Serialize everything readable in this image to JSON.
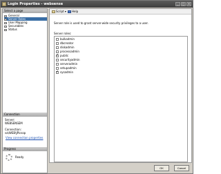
{
  "window": {
    "title": "Login Properties - websense",
    "controls": [
      "_",
      "□",
      "✕"
    ]
  },
  "left": {
    "select_page_header": "Select a page",
    "pages": [
      {
        "label": "General",
        "selected": false
      },
      {
        "label": "Server Roles",
        "selected": true
      },
      {
        "label": "User Mapping",
        "selected": false
      },
      {
        "label": "Securables",
        "selected": false
      },
      {
        "label": "Status",
        "selected": false
      }
    ],
    "connection_header": "Connection",
    "server_label": "Server:",
    "server_value": "WEBSENSEM",
    "connection_label": "Connection:",
    "connection_value": "sa\\WEB\\JPicsop",
    "view_link": "View connection properties",
    "progress_header": "Progress",
    "progress_status": "Ready"
  },
  "toolbar": {
    "script_label": "Script",
    "help_label": "Help"
  },
  "main": {
    "description": "Server role is used to grant server-wide security privileges to a user.",
    "roles_label": "Server roles:",
    "roles": [
      {
        "name": "bulkadmin",
        "checked": false
      },
      {
        "name": "dbcreator",
        "checked": false
      },
      {
        "name": "diskadmin",
        "checked": false
      },
      {
        "name": "processadmin",
        "checked": false
      },
      {
        "name": "public",
        "checked": true
      },
      {
        "name": "securityadmin",
        "checked": false
      },
      {
        "name": "serveradmin",
        "checked": false
      },
      {
        "name": "setupadmin",
        "checked": false
      },
      {
        "name": "sysadmin",
        "checked": true
      }
    ]
  },
  "buttons": {
    "ok": "OK",
    "cancel": "Cancel"
  }
}
